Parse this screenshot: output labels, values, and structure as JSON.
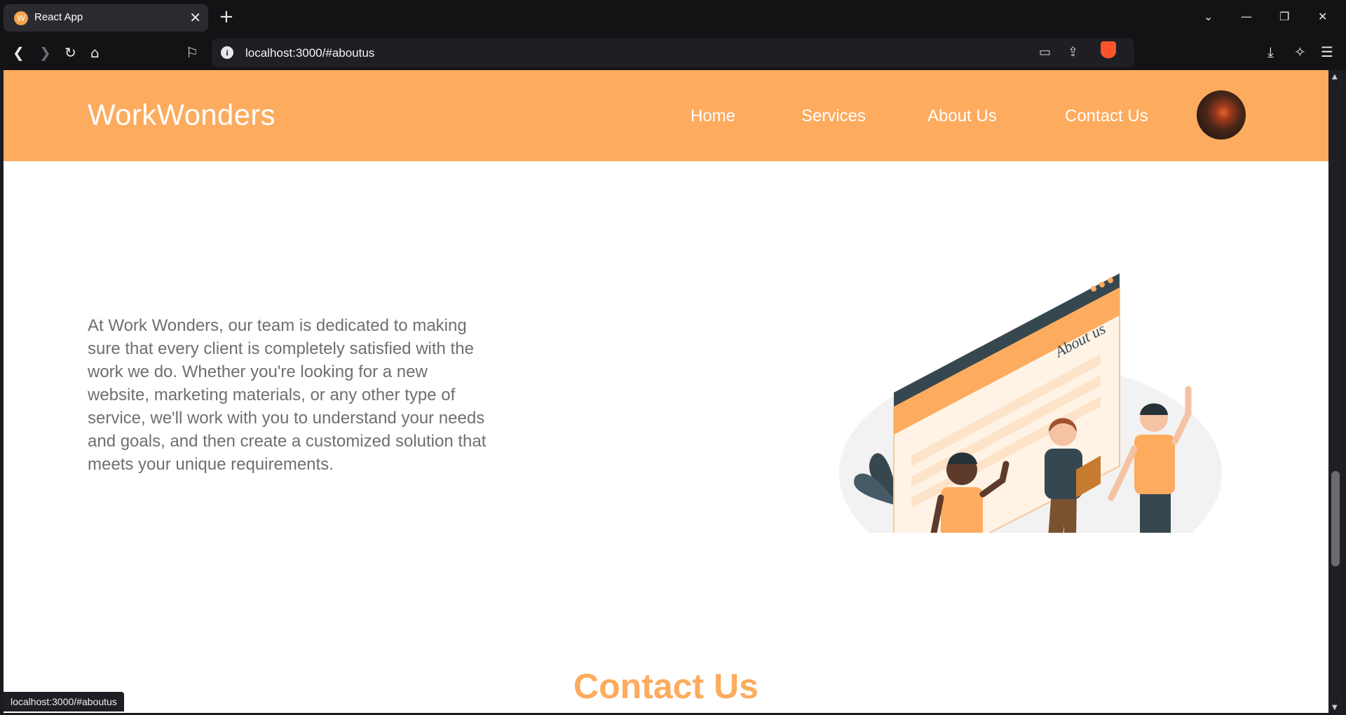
{
  "browser": {
    "tab_title": "React App",
    "favicon_letter": "W",
    "url": "localhost:3000/#aboutus",
    "status_url": "localhost:3000/#aboutus"
  },
  "site": {
    "brand": "WorkWonders",
    "nav": [
      {
        "label": "Home"
      },
      {
        "label": "Services"
      },
      {
        "label": "About Us"
      },
      {
        "label": "Contact Us"
      }
    ],
    "accent_color": "#fdab5e"
  },
  "about": {
    "paragraph": "At Work Wonders, our team is dedicated to making sure that every client is completely satisfied with the work we do. Whether you're looking for a new website, marketing materials, or any other type of service, we'll work with you to understand your needs and goals, and then create a customized solution that meets your unique requirements.",
    "illustration_caption": "About us"
  },
  "contact": {
    "title": "Contact Us"
  }
}
